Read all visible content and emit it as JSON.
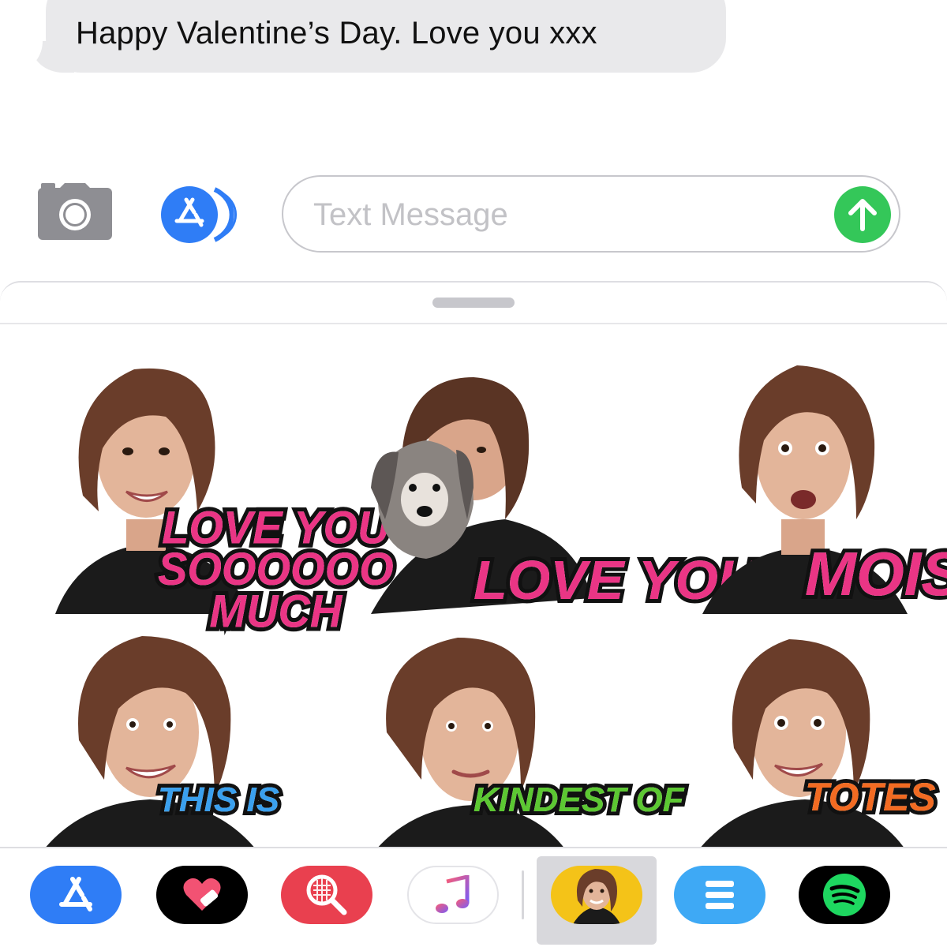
{
  "conversation": {
    "incoming_message": "Happy Valentine’s Day. Love you xxx"
  },
  "compose": {
    "placeholder": "Text Message"
  },
  "stickers": [
    {
      "caption_lines": [
        "LOVE YOU",
        "SOOOOOO",
        "MUCH"
      ],
      "color": "#ea3585"
    },
    {
      "caption_lines": [
        "LOVE YOU"
      ],
      "color": "#ea3585"
    },
    {
      "caption_lines": [
        "MOIST!"
      ],
      "color": "#ea3585"
    },
    {
      "caption_lines": [
        "THIS IS"
      ],
      "color": "#3aa0ee"
    },
    {
      "caption_lines": [
        "KINDEST OF"
      ],
      "color": "#5cc832"
    },
    {
      "caption_lines": [
        "TOTES"
      ],
      "color": "#f26b22"
    }
  ],
  "tray": {
    "apps": [
      {
        "icon": "app-store-icon",
        "bg": "#2f7df6"
      },
      {
        "icon": "heart-sticker-icon",
        "bg": "#000000"
      },
      {
        "icon": "search-images-icon",
        "bg": "#e9404f"
      },
      {
        "icon": "music-icon",
        "bg": "#ffffff"
      },
      {
        "icon": "sticker-pack-icon",
        "bg": "#f4c318"
      },
      {
        "icon": "more-apps-icon",
        "bg": "#3ea9f5"
      },
      {
        "icon": "spotify-icon",
        "bg": "#000000"
      }
    ]
  },
  "colors": {
    "bubble": "#e9e9eb",
    "send": "#34c759",
    "accent_blue": "#2f7df6"
  }
}
